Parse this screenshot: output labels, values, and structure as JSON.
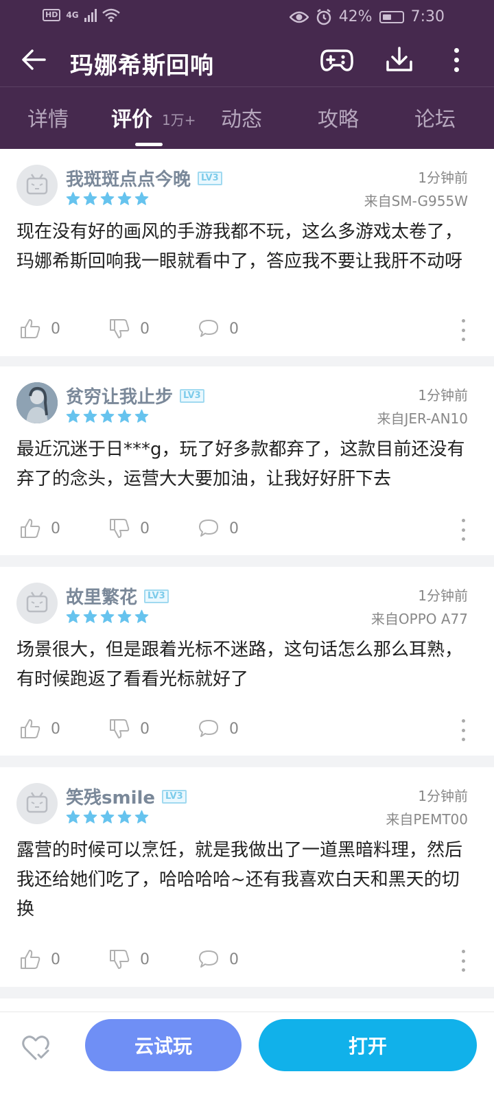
{
  "status_bar": {
    "network": "4G",
    "battery_percent": "42%",
    "time": "7:30"
  },
  "header": {
    "title": "玛娜希斯回响"
  },
  "tabs": [
    {
      "label": "详情"
    },
    {
      "label": "评价",
      "count": "1万+"
    },
    {
      "label": "动态"
    },
    {
      "label": "攻略"
    },
    {
      "label": "论坛"
    }
  ],
  "reviews": [
    {
      "username": "我斑斑点点今晚",
      "level": "LV3",
      "rating": 5,
      "time": "1分钟前",
      "device": "来自SM-G955W",
      "content": "现在没有好的画风的手游我都不玩，这么多游戏太卷了，玛娜希斯回响我一眼就看中了，答应我不要让我肝不动呀",
      "likes": "0",
      "dislikes": "0",
      "comments": "0"
    },
    {
      "username": "贫穷让我止步",
      "level": "LV3",
      "rating": 5,
      "time": "1分钟前",
      "device": "来自JER-AN10",
      "content": "最近沉迷于日***g，玩了好多款都弃了，这款目前还没有弃了的念头，运营大大要加油，让我好好肝下去",
      "likes": "0",
      "dislikes": "0",
      "comments": "0"
    },
    {
      "username": "故里繁花",
      "level": "LV3",
      "rating": 5,
      "time": "1分钟前",
      "device": "来自OPPO A77",
      "content": "场景很大，但是跟着光标不迷路，这句话怎么那么耳熟，有时候跑返了看看光标就好了",
      "likes": "0",
      "dislikes": "0",
      "comments": "0"
    },
    {
      "username": "笑残smile",
      "level": "LV3",
      "rating": 5,
      "time": "1分钟前",
      "device": "来自PEMT00",
      "content": "露营的时候可以烹饪，就是我做出了一道黑暗料理，然后我还给她们吃了，哈哈哈哈~还有我喜欢白天和黑天的切换",
      "likes": "0",
      "dislikes": "0",
      "comments": "0"
    }
  ],
  "bottom_bar": {
    "try_label": "云试玩",
    "open_label": "打开"
  },
  "colors": {
    "header_bg": "#46294e",
    "star": "#66c3ee",
    "try_button": "#6f8ff5",
    "open_button": "#11b1ea"
  }
}
